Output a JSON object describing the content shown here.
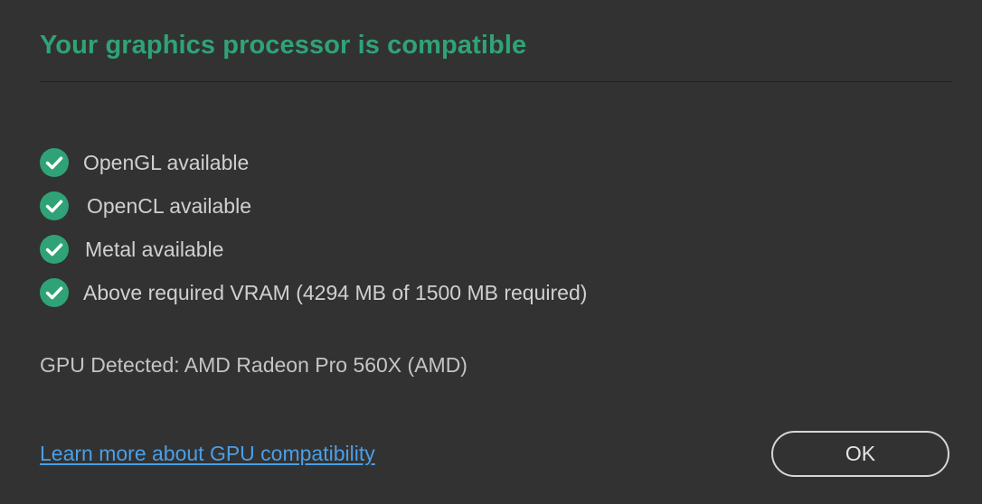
{
  "dialog": {
    "title": "Your graphics processor is compatible",
    "accent_color": "#2fa377",
    "checks": [
      {
        "label": "OpenGL available",
        "icon": "check-circle-icon",
        "status": "passed"
      },
      {
        "label": "OpenCL available",
        "icon": "check-circle-icon",
        "status": "passed"
      },
      {
        "label": "Metal available",
        "icon": "check-circle-icon",
        "status": "passed"
      },
      {
        "label": "Above required VRAM (4294 MB of 1500 MB required)",
        "icon": "check-circle-icon",
        "status": "passed"
      }
    ],
    "gpu_detected": "GPU Detected: AMD Radeon Pro 560X (AMD)",
    "learn_more_link": "Learn more about GPU compatibility",
    "ok_button_label": "OK",
    "link_color": "#4a9fe8",
    "background_color": "#323232"
  }
}
